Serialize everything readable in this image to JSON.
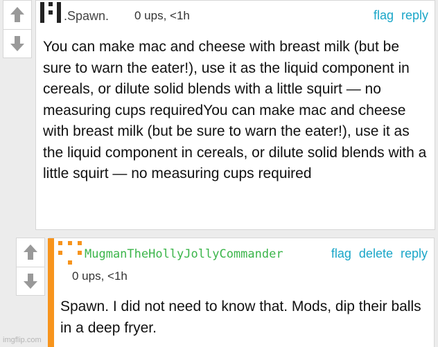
{
  "comments": [
    {
      "username": ".Spawn.",
      "meta": "0 ups, <1h",
      "actions": [
        "flag",
        "reply"
      ],
      "body": "You can make mac and cheese with breast milk (but be sure to warn the eater!), use it as the liquid component in cereals, or dilute solid blends with a little squirt — no measuring cups requiredYou can make mac and cheese with breast milk (but be sure to warn the eater!), use it as the liquid component in cereals, or dilute solid blends with a little squirt — no measuring cups required",
      "username_color": "#444444",
      "avatar_color": "#222222"
    },
    {
      "username": "MugmanTheHollyJollyCommander",
      "meta": "0 ups, <1h",
      "actions": [
        "flag",
        "delete",
        "reply"
      ],
      "body": "Spawn. I did not need to know that. Mods, dip their balls in a deep fryer.",
      "username_color": "#3bb54a",
      "avatar_color": "#f7941d",
      "accent_color": "#f7941d"
    }
  ],
  "icons": {
    "upvote": "arrow-up-icon",
    "downvote": "arrow-down-icon"
  },
  "watermark": "imgflip.com"
}
